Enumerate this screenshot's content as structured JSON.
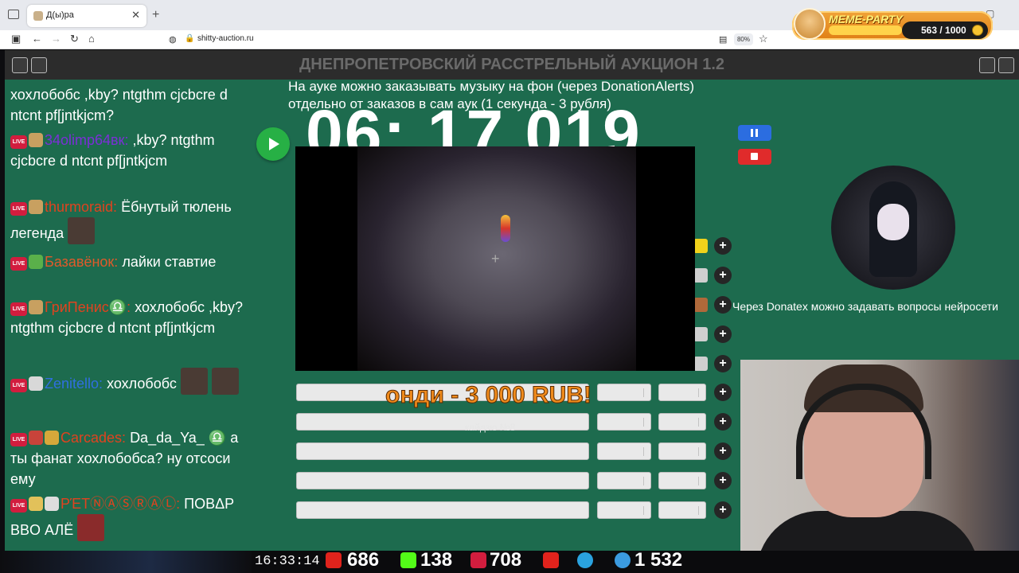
{
  "browser": {
    "tab_title": "Д(ы)ра",
    "url": "shitty-auction.ru",
    "zoom": "80%"
  },
  "meme_party": {
    "title": "MEME-PARTY",
    "count": "563 / 1000"
  },
  "header": {
    "title": "ДНЕПРОПЕТРОВСКИЙ РАССТРЕЛЬНЫЙ АУКЦИОН 1.2"
  },
  "notice": {
    "line1": "На ауке можно заказывать музыку на фон (через DonationAlerts)",
    "line2": "отдельно от заказов в сам аук (1 секунда - 3 рубля)"
  },
  "timer": "06: 17.019",
  "donation": {
    "text": "онди - 3 000 RUB!",
    "sub": "кайдзю №8"
  },
  "donatex_text": "Через Donatex можно задавать вопросы нейросети",
  "chat": [
    {
      "nick": "",
      "text": "хохлобобс ,kby? ntgthm cjcbcre d ntcnt pf[jntkjcm?"
    },
    {
      "nick": "34olimp64вк:",
      "nick_color": "#7b2fd6",
      "text": ",kby? ntgthm cjcbcre d ntcnt pf[jntkjcm"
    },
    {
      "nick": "thurmoraid:",
      "nick_color": "#e0431f",
      "text": "Ёбнутый тюлень легенда"
    },
    {
      "nick": "Базавёнок:",
      "nick_color": "#e05a2a",
      "text": "лайки ставтие"
    },
    {
      "nick": "ГриПенис♎:",
      "nick_color": "#e0431f",
      "text": "хохлобобс ,kby? ntgthm cjcbcre d ntcnt pf[jntkjcm"
    },
    {
      "nick": "Zenitello:",
      "nick_color": "#2f6fe0",
      "text": "хохлобобс"
    },
    {
      "nick": "Carcades:",
      "nick_color": "#e0431f",
      "text": "Da_da_Ya_ ♎ а ты фанат хохлобобса? ну отсоси ему"
    },
    {
      "nick": "ΡΈΤⓃⒶⓈⓇⒶⓁ:",
      "nick_color": "#e0431f",
      "text": "ΠΟΒΔΡ ΒΒΟ АЛЁ"
    }
  ],
  "stats": {
    "time": "16:33:14",
    "youtube": "686",
    "kick": "138",
    "live": "708",
    "viewers": "1 532"
  },
  "colors": {
    "page_bg": "#1d6b4e",
    "header_bg": "#2c2c2c",
    "play": "#27b045",
    "pause": "#2b6de0",
    "stop": "#e02b2b"
  }
}
